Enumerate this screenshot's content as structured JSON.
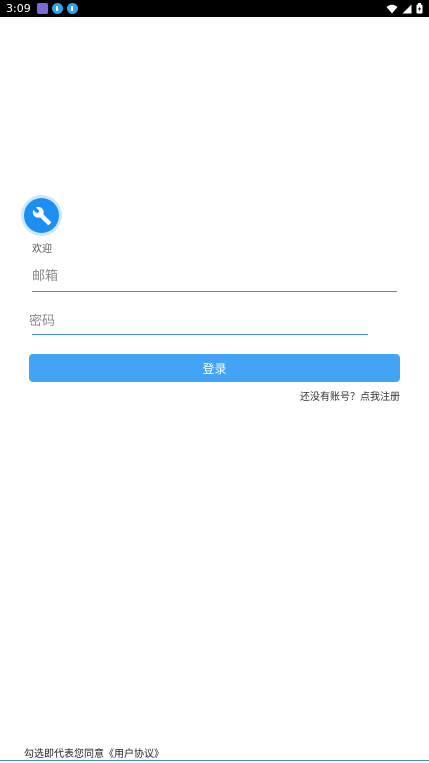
{
  "status_bar": {
    "time": "3:09",
    "notification_icons": [
      "calendar-notification-icon",
      "download-icon",
      "download-icon"
    ],
    "system_icons": [
      "wifi-icon",
      "cellular-signal-icon",
      "battery-icon"
    ]
  },
  "app": {
    "logo_icon": "wrench-icon",
    "welcome_text": "欢迎",
    "accent_color": "#43a4f5"
  },
  "form": {
    "email_placeholder": "邮箱",
    "email_value": "",
    "password_placeholder": "密码",
    "password_value": "",
    "login_label": "登录",
    "register_link": "还没有账号？点我注册"
  },
  "footer": {
    "agreement_text": "勾选即代表您同意《用户协议》"
  }
}
